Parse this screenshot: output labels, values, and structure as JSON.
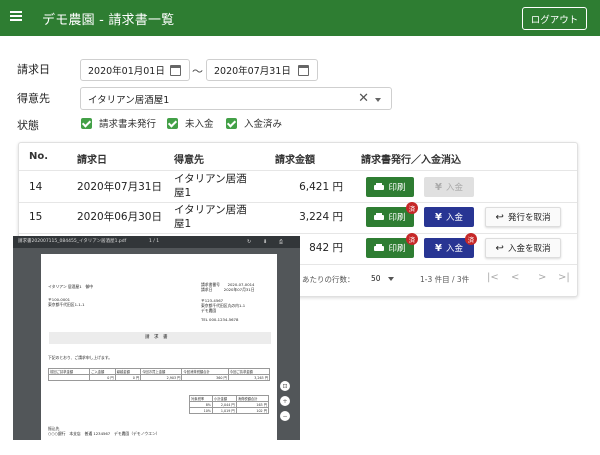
{
  "appbar": {
    "title": "デモ農園 - 請求書一覧",
    "logout_label": "ログアウト",
    "menu_icon": "menu-icon"
  },
  "filters": {
    "date_label": "請求日",
    "date_from": "2020年01月01日",
    "date_separator": "〜",
    "date_to": "2020年07月31日",
    "customer_label": "得意先",
    "customer_value": "イタリアン居酒屋1",
    "clear_glyph": "✕",
    "status_label": "状態",
    "statuses": [
      "請求書未発行",
      "未入金",
      "入金済み"
    ]
  },
  "table": {
    "headers": [
      "No.",
      "請求日",
      "得意先",
      "請求金額",
      "請求書発行／入金消込"
    ],
    "rows": [
      {
        "no": "14",
        "date": "2020年07月31日",
        "customer": "イタリアン居酒屋1",
        "amount": "6,421 円"
      },
      {
        "no": "15",
        "date": "2020年06月30日",
        "customer": "イタリアン居酒屋1",
        "amount": "3,224 円"
      },
      {
        "no": "",
        "date": "",
        "customer": "",
        "amount": "842 円"
      }
    ],
    "print_label": "印刷",
    "pay_label": "入金",
    "cancel_issue_label": "発行を取消",
    "cancel_pay_label": "入金を取消",
    "badge_label": "済",
    "rows_per_page_label": "あたりの行数：",
    "rows_per_page": "50",
    "range_text": "1-3 件目 / 3件",
    "pager": [
      "|<",
      "<",
      ">",
      ">|"
    ]
  },
  "pdf": {
    "filename": "請求書202007115_084455_イタリアン居酒屋1.pdf",
    "page_indicator": "1 / 1",
    "to_name": "イタリアン 居酒屋1　御中",
    "to_zip": "〒100-0001",
    "to_addr": "東京都千代田区1-1-1",
    "meta_lines": [
      "請求書番号　　2020-07-0014",
      "請求日　　　2020年07月31日",
      "〒123-4567",
      "東京都千代田区丸の内1-1",
      "デモ農園",
      "TEL 000-1234-5678"
    ],
    "doc_title": "請　求　書",
    "intro": "下記のとおり、ご請求申し上げます。",
    "sum_headers": [
      "前回ご請求金額",
      "ご入金額",
      "繰越金額",
      "今回お買上金額",
      "今回消費税額合計",
      "今回ご請求金額"
    ],
    "sum_values": [
      "",
      "0 円",
      "0 円",
      "2,903 円",
      "360 円",
      "3,263 円"
    ],
    "tax_headers": [
      "対象税率",
      "小計金額",
      "消費税額合計"
    ],
    "tax_rows": [
      [
        "8%",
        "2,044 円",
        "163 円"
      ],
      [
        "10%",
        "1,019 円",
        "102 円"
      ]
    ],
    "bank_label": "振込先",
    "bank_text": "○○○銀行　本支店　普通 1234567　デモ農園（デモノウエン）"
  }
}
